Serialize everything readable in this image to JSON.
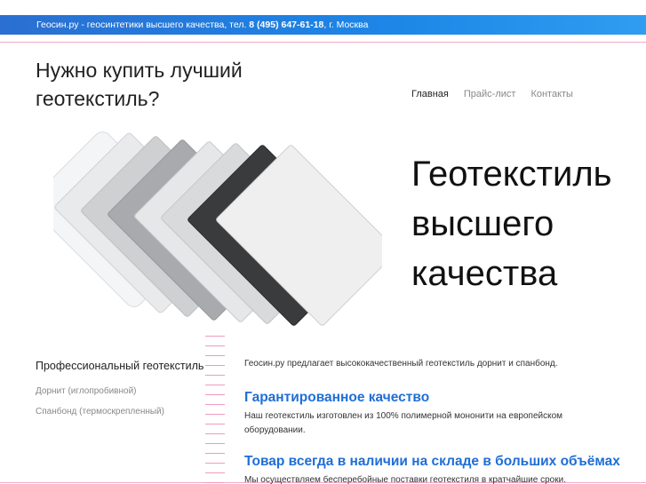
{
  "topbar": {
    "prefix": "Геосин.ру - геосинтетики высшего качества, тел. ",
    "phone": "8 (495) 647-61-18",
    "suffix": ", г. Москва"
  },
  "headline": "Нужно купить лучший геотекстиль?",
  "nav": {
    "items": [
      {
        "label": "Главная",
        "active": true
      },
      {
        "label": "Прайс-лист",
        "active": false
      },
      {
        "label": "Контакты",
        "active": false
      }
    ]
  },
  "slogan": {
    "line1": "Геотекстиль",
    "line2": "высшего",
    "line3": "качества"
  },
  "sidebar": {
    "title": "Профессиональный геотекстиль",
    "links": [
      "Дорнит (иглопробивной)",
      "Спанбонд (термоскрепленный)"
    ]
  },
  "content": {
    "intro": "Геосин.ру предлагает высококачественный геотекстиль дорнит и спанбонд.",
    "sections": [
      {
        "title": "Гарантированное качество",
        "text": "Наш геотекстиль изготовлен из 100% полимерной мононити на европейском оборудовании."
      },
      {
        "title": "Товар всегда в наличии на складе в больших объёмах",
        "text": "Мы осуществляем бесперебойные поставки геотекстиля в кратчайшие сроки."
      }
    ]
  },
  "colors": {
    "accent": "#1f6ed6",
    "topbar": "#1d86e6",
    "pink": "#f09abf"
  }
}
